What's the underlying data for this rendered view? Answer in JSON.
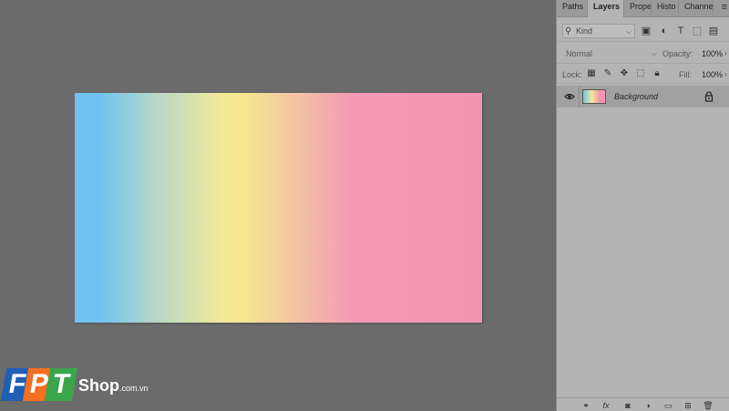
{
  "panel": {
    "tabs": [
      {
        "label": "Paths",
        "active": false
      },
      {
        "label": "Layers",
        "active": true
      },
      {
        "label": "Prope",
        "active": false
      },
      {
        "label": "Histo",
        "active": false
      },
      {
        "label": "Channe",
        "active": false
      }
    ],
    "filter": {
      "kind_label": "Kind",
      "icons": [
        "image-filter-icon",
        "adjustment-filter-icon",
        "type-filter-icon",
        "shape-filter-icon",
        "smart-object-filter-icon"
      ]
    },
    "blend_mode": "Normal",
    "opacity_label": "Opacity:",
    "opacity_value": "100%",
    "lock_label": "Lock:",
    "lock_icons": [
      "lock-transparent-pixels-icon",
      "lock-image-pixels-icon",
      "lock-position-icon",
      "lock-artboard-icon",
      "lock-all-icon"
    ],
    "fill_label": "Fill:",
    "fill_value": "100%",
    "layers": [
      {
        "name": "Background",
        "visible": true,
        "locked": true
      }
    ],
    "bottom_icons": [
      "link-layers-icon",
      "fx-icon",
      "add-mask-icon",
      "adjustment-layer-icon",
      "new-group-icon",
      "new-layer-icon",
      "delete-layer-icon"
    ]
  },
  "watermark": {
    "letters": [
      "F",
      "P",
      "T"
    ],
    "shop": "Shop",
    "domain": ".com.vn",
    "colors": {
      "f": "#1f5fb6",
      "p": "#f36f21",
      "t": "#3aa54a"
    }
  },
  "canvas": {
    "gradient_colors": [
      "#6fc3f0",
      "#f1ea98",
      "#f3c2a6",
      "#f494b3"
    ]
  }
}
